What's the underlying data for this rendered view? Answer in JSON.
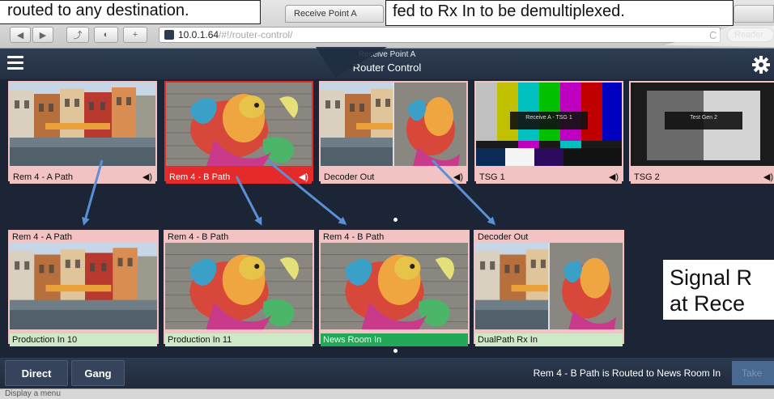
{
  "browser": {
    "tab_title": "Receive Point A",
    "url_host": "10.0.1.64",
    "url_path": "/#!/router-control/",
    "reader_label": "Reader",
    "back_glyph": "◀",
    "forward_glyph": "▶",
    "share_glyph": "⤴",
    "shield_glyph": "◐",
    "add_glyph": "+",
    "reload_glyph": "C"
  },
  "header": {
    "subtitle": "Receive Point A",
    "title": "Router Control",
    "menu_icon": "hamburger-icon",
    "settings_icon": "gear-icon"
  },
  "sources": [
    {
      "label": "Rem 4 - A Path",
      "image": "canal-street",
      "audio": true,
      "selected": false
    },
    {
      "label": "Rem 4 - B Path",
      "image": "phoenix-sculpture",
      "audio": true,
      "selected": true
    },
    {
      "label": "Decoder Out",
      "image": "split-street-phoenix",
      "audio": true,
      "selected": false
    },
    {
      "label": "TSG 1",
      "image": "color-bars",
      "overlay": "Receive A - TSG 1",
      "audio": true,
      "selected": false
    },
    {
      "label": "TSG 2",
      "image": "gray-pattern",
      "overlay": "Test Gen 2",
      "audio": true,
      "selected": false
    }
  ],
  "destinations": [
    {
      "source": "Rem 4 - A Path",
      "label": "Production In 10",
      "image": "canal-street",
      "active": false
    },
    {
      "source": "Rem 4 - B Path",
      "label": "Production In 11",
      "image": "phoenix-sculpture",
      "active": false
    },
    {
      "source": "Rem 4 - B Path",
      "label": "News Room In",
      "image": "phoenix-sculpture",
      "active": true
    },
    {
      "source": "Decoder Out",
      "label": "DualPath Rx In",
      "image": "split-street-phoenix",
      "active": false
    }
  ],
  "bottom_bar": {
    "direct_label": "Direct",
    "gang_label": "Gang",
    "status": "Rem 4 - B Path is Routed to News Room In",
    "take_label": "Take"
  },
  "status_strip": "Display a menu",
  "annotations": {
    "left": "routed to any destination.",
    "top": "fed to Rx In to be demultiplexed.",
    "signal_line1": "Signal R",
    "signal_line2": "at Rece"
  },
  "colors": {
    "header_bg": "#2b384c",
    "unselected_label": "#f3c3c4",
    "selected_source": "#e52a2a",
    "destination_label": "#cfe8c7",
    "active_destination": "#21a957",
    "arrow": "#5b8fd6"
  }
}
